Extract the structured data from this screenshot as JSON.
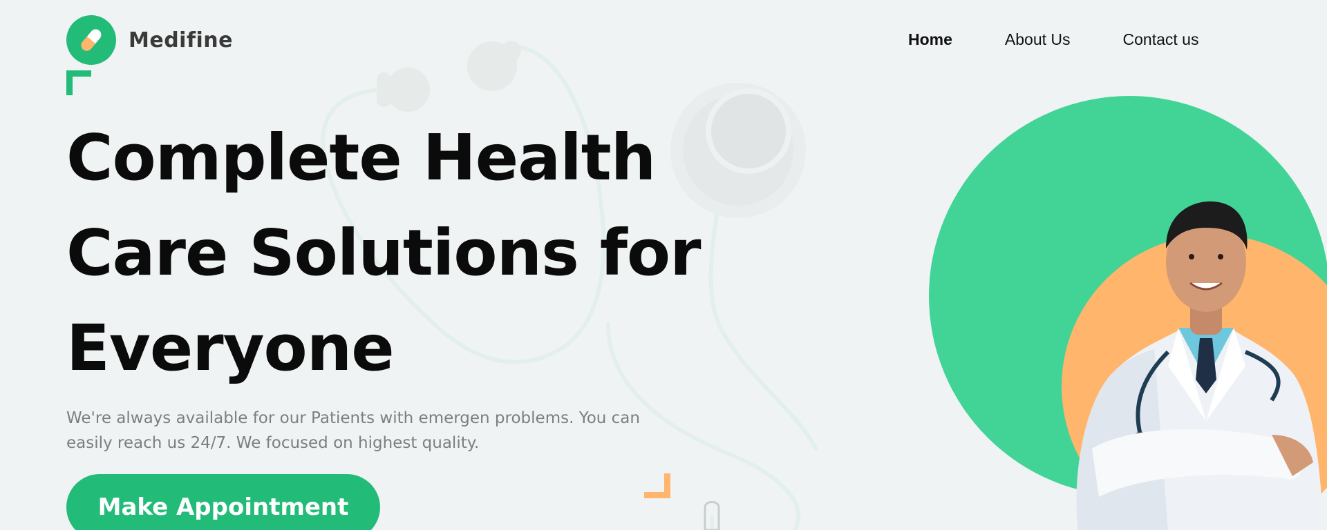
{
  "brand": {
    "name": "Medifine",
    "primary_color": "#22bb78",
    "accent_color": "#ffb56b",
    "icon": "capsule-icon"
  },
  "nav": {
    "items": [
      "Home",
      "About Us",
      "Contact us"
    ],
    "active": "Home"
  },
  "hero": {
    "headline_lines": [
      "Complete Health",
      "Care Solutions for",
      "Everyone"
    ],
    "subtext_lines": [
      "We're always available for our Patients with emergen problems. You can",
      "easily reach us 24/7. We focused on highest quality."
    ],
    "cta_label": "Make Appointment"
  },
  "art": {
    "background_decoration": "stethoscope-icon",
    "portrait": "doctor-portrait"
  }
}
